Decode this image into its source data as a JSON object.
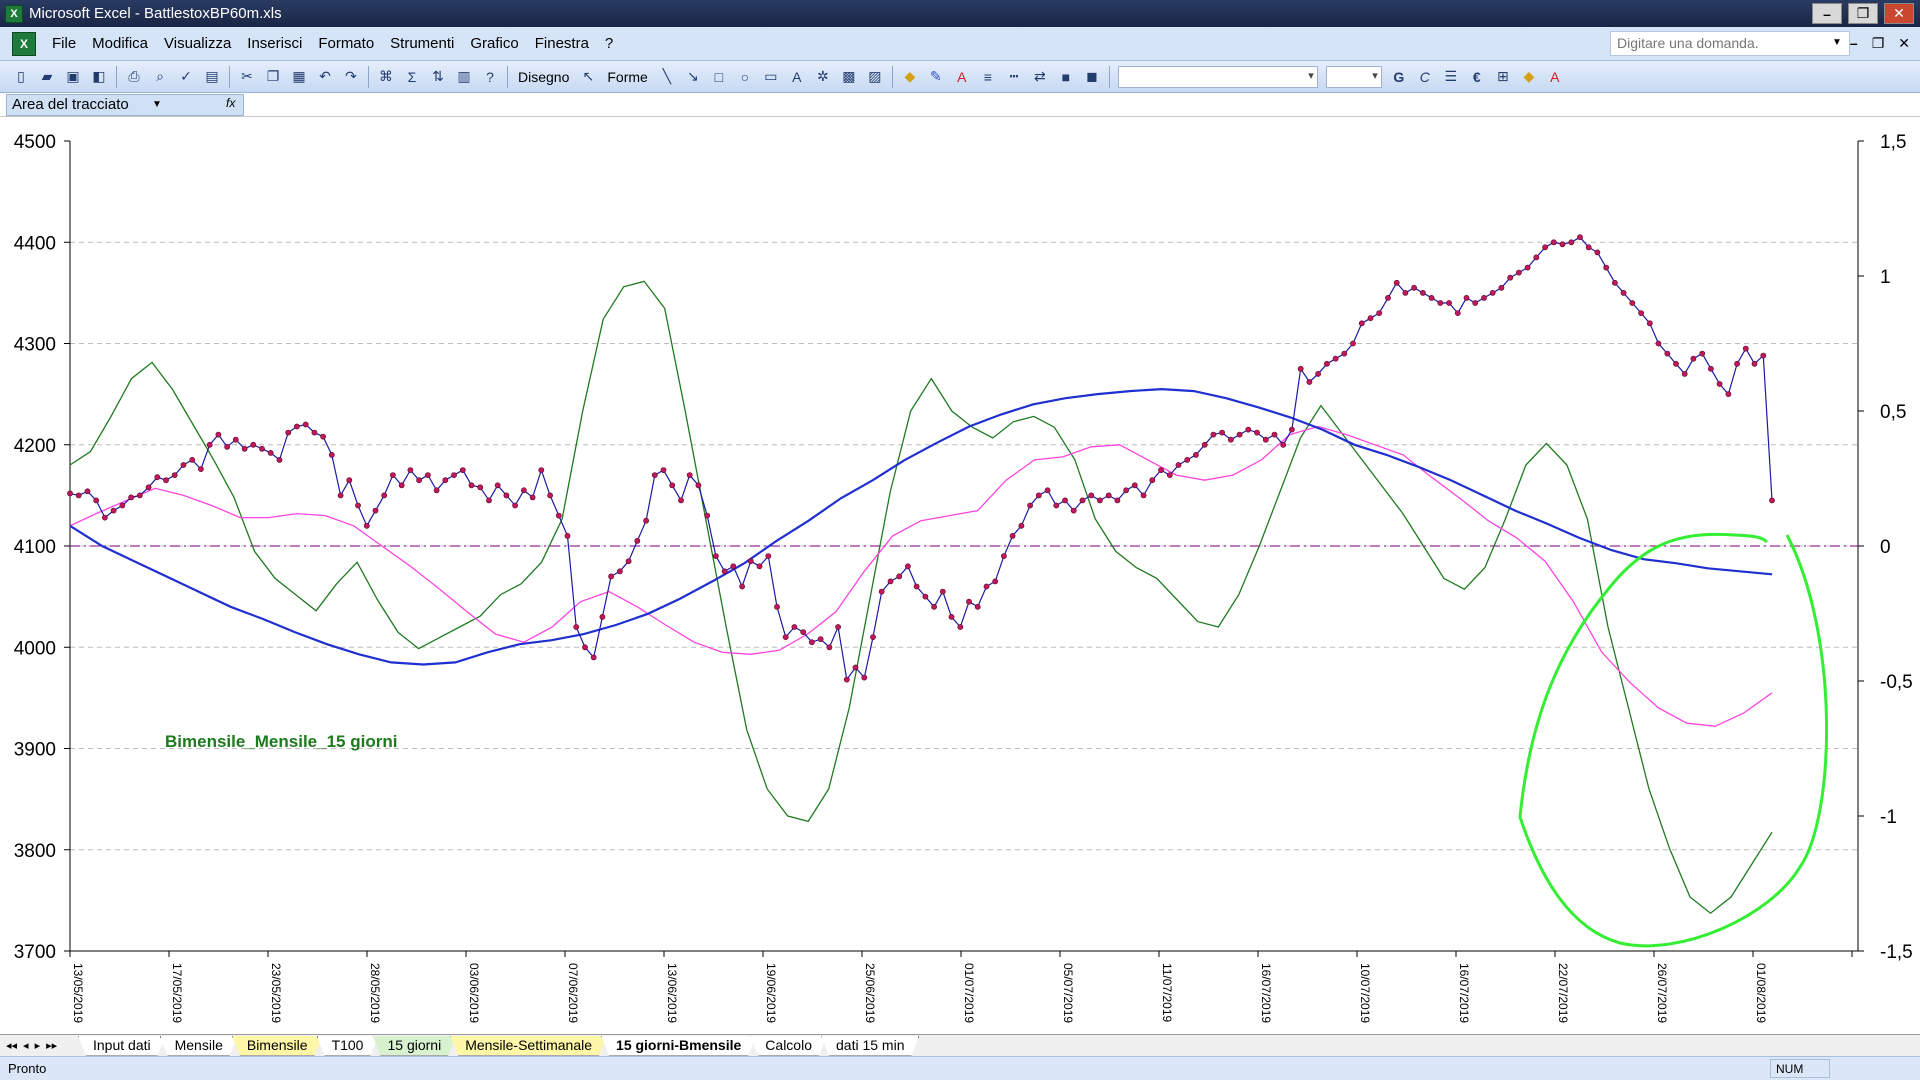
{
  "window": {
    "title": "Microsoft Excel - BattlestoxBP60m.xls",
    "app_icon_glyph": "X",
    "minimize": "–",
    "maximize": "❐",
    "close": "✕"
  },
  "menu": {
    "items": [
      "File",
      "Modifica",
      "Visualizza",
      "Inserisci",
      "Formato",
      "Strumenti",
      "Grafico",
      "Finestra",
      "?"
    ],
    "ask_placeholder": "Digitare una domanda.",
    "doc_minimize": "–",
    "doc_restore": "❐",
    "doc_close": "✕"
  },
  "toolbar": {
    "disegno": "Disegno",
    "forme": "Forme",
    "euro": "€",
    "bold": "G",
    "italic": "C"
  },
  "namebar": {
    "name_box": "Area del tracciato",
    "fx": "fx"
  },
  "chart_data": {
    "type": "line",
    "annotation": "Bimensile_Mensile_15 giorni",
    "left_axis": {
      "min": 3700,
      "max": 4500,
      "ticks": [
        "4500",
        "4400",
        "4300",
        "4200",
        "4100",
        "4000",
        "3900",
        "3800",
        "3700"
      ]
    },
    "right_axis": {
      "min": -1.5,
      "max": 1.5,
      "ticks": [
        "1,5",
        "1",
        "0,5",
        "0",
        "-0,5",
        "-1",
        "-1,5"
      ]
    },
    "x_dates": [
      "13/05/2019",
      "17/05/2019",
      "23/05/2019",
      "28/05/2019",
      "03/06/2019",
      "07/06/2019",
      "13/06/2019",
      "19/06/2019",
      "25/06/2019",
      "01/07/2019",
      "05/07/2019",
      "11/07/2019",
      "16/07/2019",
      "10/07/2019",
      "16/07/2019",
      "22/07/2019",
      "26/07/2019",
      "01/08/2019"
    ],
    "grid": "horizontal dashed",
    "colors": {
      "price": "#1a1aa6",
      "price_marker": "#c2185b",
      "bimensile": "#1f2fd0",
      "mensile": "#ff44e0",
      "oscillator": "#1f7a1f",
      "zero_line": "#9a2a9a",
      "hand_circle": "#33ee33"
    },
    "series": [
      {
        "role": "price",
        "axis": "left",
        "values": [
          4152,
          4150,
          4154,
          4145,
          4128,
          4135,
          4140,
          4148,
          4150,
          4158,
          4168,
          4165,
          4170,
          4180,
          4185,
          4176,
          4200,
          4210,
          4198,
          4205,
          4196,
          4200,
          4196,
          4192,
          4185,
          4212,
          4218,
          4220,
          4212,
          4208,
          4190,
          4150,
          4165,
          4140,
          4120,
          4135,
          4150,
          4170,
          4160,
          4175,
          4165,
          4170,
          4155,
          4165,
          4170,
          4175,
          4160,
          4158,
          4145,
          4160,
          4150,
          4140,
          4155,
          4148,
          4175,
          4150,
          4130,
          4110,
          4020,
          4000,
          3990,
          4030,
          4070,
          4075,
          4085,
          4105,
          4125,
          4170,
          4175,
          4160,
          4145,
          4170,
          4160,
          4130,
          4090,
          4075,
          4080,
          4060,
          4085,
          4080,
          4090,
          4040,
          4010,
          4020,
          4015,
          4005,
          4008,
          4000,
          4020,
          3968,
          3980,
          3970,
          4010,
          4055,
          4065,
          4070,
          4080,
          4060,
          4050,
          4040,
          4055,
          4030,
          4020,
          4045,
          4040,
          4060,
          4065,
          4090,
          4110,
          4120,
          4140,
          4150,
          4155,
          4140,
          4145,
          4135,
          4145,
          4150,
          4145,
          4150,
          4145,
          4155,
          4160,
          4150,
          4165,
          4175,
          4170,
          4180,
          4185,
          4190,
          4200,
          4210,
          4212,
          4205,
          4210,
          4215,
          4212,
          4205,
          4210,
          4200,
          4215,
          4275,
          4262,
          4270,
          4280,
          4285,
          4290,
          4300,
          4320,
          4325,
          4330,
          4345,
          4360,
          4350,
          4355,
          4350,
          4345,
          4340,
          4340,
          4330,
          4345,
          4340,
          4345,
          4350,
          4355,
          4365,
          4370,
          4375,
          4385,
          4395,
          4400,
          4398,
          4400,
          4405,
          4395,
          4390,
          4375,
          4360,
          4350,
          4340,
          4330,
          4320,
          4300,
          4290,
          4280,
          4270,
          4285,
          4290,
          4275,
          4260,
          4250,
          4280,
          4295,
          4280,
          4288,
          4145
        ]
      },
      {
        "role": "bimensile",
        "axis": "left",
        "values": [
          4120,
          4100,
          4085,
          4070,
          4055,
          4040,
          4028,
          4015,
          4003,
          3993,
          3985,
          3983,
          3985,
          3995,
          4003,
          4007,
          4013,
          4022,
          4033,
          4048,
          4065,
          4083,
          4105,
          4125,
          4147,
          4165,
          4185,
          4202,
          4218,
          4230,
          4240,
          4246,
          4250,
          4253,
          4255,
          4253,
          4246,
          4237,
          4227,
          4215,
          4200,
          4190,
          4178,
          4165,
          4150,
          4135,
          4122,
          4108,
          4096,
          4087,
          4083,
          4078,
          4075,
          4072
        ]
      },
      {
        "role": "mensile",
        "axis": "left",
        "values": [
          4120,
          4133,
          4145,
          4157,
          4150,
          4140,
          4128,
          4128,
          4132,
          4130,
          4120,
          4100,
          4080,
          4058,
          4035,
          4013,
          4005,
          4020,
          4045,
          4055,
          4040,
          4022,
          4005,
          3995,
          3993,
          3997,
          4013,
          4035,
          4075,
          4110,
          4125,
          4130,
          4135,
          4165,
          4185,
          4188,
          4198,
          4200,
          4185,
          4170,
          4165,
          4170,
          4185,
          4210,
          4218,
          4210,
          4200,
          4190,
          4168,
          4147,
          4125,
          4108,
          4085,
          4045,
          3995,
          3965,
          3940,
          3925,
          3922,
          3935,
          3955
        ]
      },
      {
        "role": "oscillator",
        "axis": "right",
        "values": [
          0.3,
          0.35,
          0.48,
          0.62,
          0.68,
          0.58,
          0.45,
          0.32,
          0.18,
          -0.02,
          -0.12,
          -0.18,
          -0.24,
          -0.14,
          -0.06,
          -0.2,
          -0.32,
          -0.38,
          -0.34,
          -0.3,
          -0.26,
          -0.18,
          -0.14,
          -0.06,
          0.1,
          0.5,
          0.84,
          0.96,
          0.98,
          0.88,
          0.5,
          0.1,
          -0.3,
          -0.68,
          -0.9,
          -1.0,
          -1.02,
          -0.9,
          -0.6,
          -0.2,
          0.2,
          0.5,
          0.62,
          0.5,
          0.44,
          0.4,
          0.46,
          0.48,
          0.44,
          0.32,
          0.1,
          -0.02,
          -0.08,
          -0.12,
          -0.2,
          -0.28,
          -0.3,
          -0.18,
          0.0,
          0.2,
          0.4,
          0.52,
          0.42,
          0.32,
          0.22,
          0.12,
          0.0,
          -0.12,
          -0.16,
          -0.08,
          0.1,
          0.3,
          0.38,
          0.3,
          0.1,
          -0.3,
          -0.6,
          -0.9,
          -1.12,
          -1.3,
          -1.36,
          -1.3,
          -1.18,
          -1.06
        ]
      }
    ]
  },
  "sheet_tabs": {
    "nav": [
      "◂◂",
      "◂",
      "▸",
      "▸▸"
    ],
    "tabs": [
      "Input dati",
      "Mensile",
      "Bimensile",
      "T100",
      "15 giorni",
      "Mensile-Settimanale",
      "15 giorni-Bmensile",
      "Calcolo",
      "dati 15 min"
    ],
    "tab_colors": [
      "#ffffff",
      "#ffffff",
      "#fff7a8",
      "#ffffff",
      "#d8f2d0",
      "#fff7a8",
      "#ffffff",
      "#ffffff",
      "#ffffff"
    ],
    "active_index": 6
  },
  "status": {
    "left": "Pronto",
    "num": "NUM"
  }
}
